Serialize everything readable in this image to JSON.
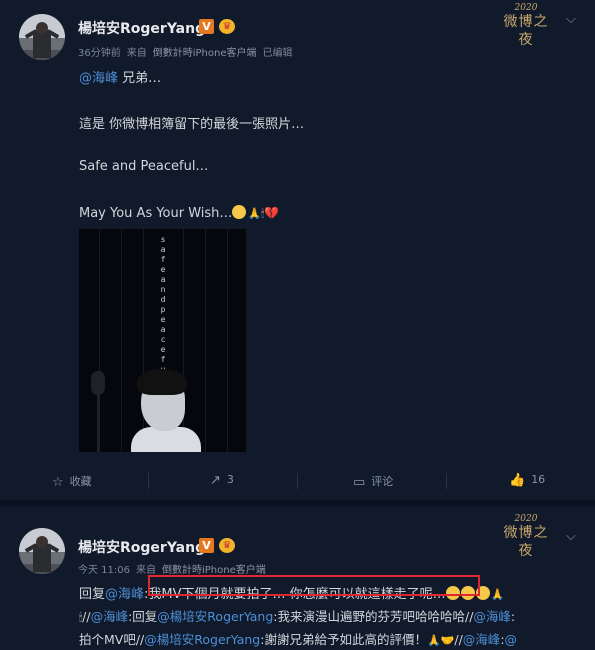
{
  "posts": [
    {
      "user": {
        "name": "楊培安RogerYang",
        "verified_badge": "V"
      },
      "meta": {
        "time": "36分钟前",
        "source_prefix": "来自",
        "source": "倒數計時iPhone客户端",
        "edited": "已编辑"
      },
      "event_logo": {
        "year": "2020",
        "name": "微博之夜"
      },
      "lines": {
        "l1_mention": "@海峰",
        "l1_text": " 兄弟…",
        "l2": "這是  你微博相簿留下的最後一張照片…",
        "l3": "Safe and Peaceful…",
        "l4": "May You As Your Wish…"
      },
      "image": {
        "vertical_text": "safe and peaceful"
      },
      "actions": {
        "favorite": "收藏",
        "repost": "3",
        "comment": "评论",
        "like": "16"
      }
    },
    {
      "user": {
        "name": "楊培安RogerYang",
        "verified_badge": "V"
      },
      "meta": {
        "time": "今天 11:06",
        "source_prefix": "来自",
        "source": "倒數計時iPhone客户端"
      },
      "event_logo": {
        "year": "2020",
        "name": "微博之夜"
      },
      "line1": {
        "reply": "回复",
        "mention": "@海峰",
        "colon": ":",
        "quote": "我MV下個月就要拍了…   你怎麼可以就這樣走了呢…"
      },
      "line2": {
        "sep1": "//",
        "mention1": "@海峰",
        "text1": ":回复",
        "mention2": "@楊培安RogerYang",
        "text2": ":我来演漫山遍野的芬芳吧哈哈哈哈//",
        "mention3": "@海峰",
        "text3": ":"
      },
      "line3": {
        "text1": "拍个MV吧//",
        "mention1": "@楊培安RogerYang",
        "text2": ":謝謝兄弟給予如此高的評價！",
        "sep": "//",
        "mention2": "@海峰",
        "text3": ":",
        "mention3": "@"
      }
    }
  ],
  "colors": {
    "background": "#0b1322",
    "card": "#101a2b",
    "link": "#4e8fd6",
    "highlight_border": "#e0262f",
    "badge": "#e6791f"
  },
  "icons": [
    "favorite-icon",
    "repost-icon",
    "comment-icon",
    "like-icon",
    "chevron-down-icon"
  ]
}
